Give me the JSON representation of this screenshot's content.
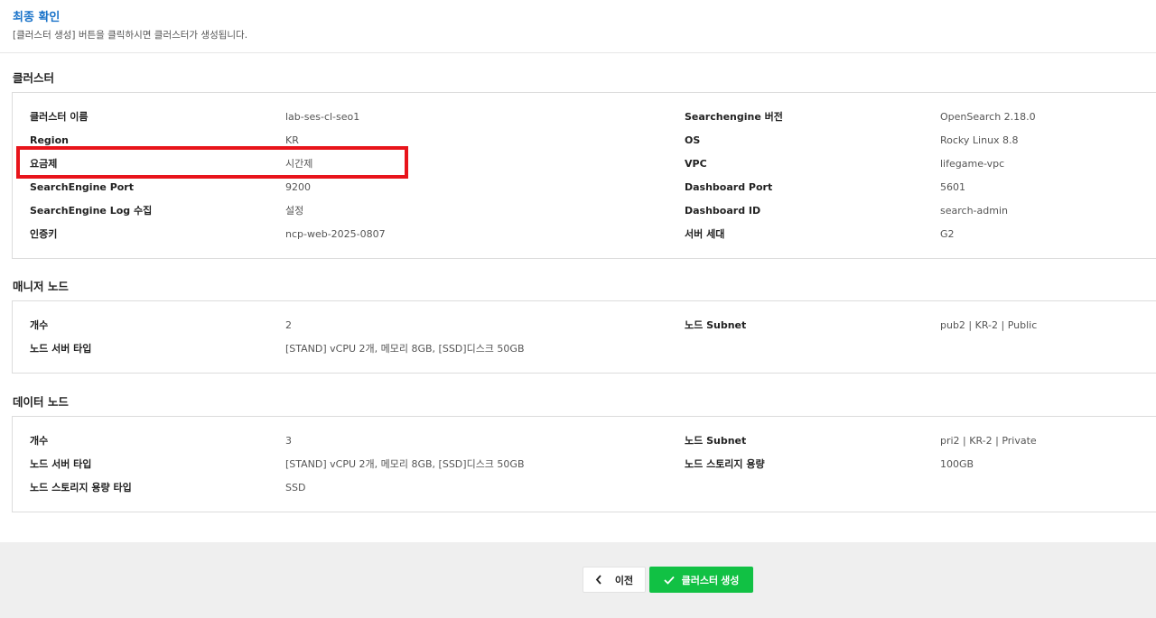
{
  "header": {
    "title": "최종 확인",
    "description": "[클러스터 생성] 버튼을 클릭하시면 클러스터가 생성됩니다."
  },
  "cluster": {
    "section_title": "클러스터",
    "left": [
      {
        "label": "클러스터 이름",
        "value": "lab-ses-cl-seo1"
      },
      {
        "label": "Region",
        "value": "KR"
      },
      {
        "label": "요금제",
        "value": "시간제"
      },
      {
        "label": "SearchEngine Port",
        "value": "9200"
      },
      {
        "label": "SearchEngine Log 수집",
        "value": "설정"
      },
      {
        "label": "인증키",
        "value": "ncp-web-2025-0807"
      }
    ],
    "right": [
      {
        "label": "Searchengine 버전",
        "value": "OpenSearch 2.18.0"
      },
      {
        "label": "OS",
        "value": "Rocky Linux 8.8"
      },
      {
        "label": "VPC",
        "value": "lifegame-vpc"
      },
      {
        "label": "Dashboard Port",
        "value": "5601"
      },
      {
        "label": "Dashboard ID",
        "value": "search-admin"
      },
      {
        "label": "서버 세대",
        "value": "G2"
      }
    ]
  },
  "manager": {
    "section_title": "매니저 노드",
    "left": [
      {
        "label": "개수",
        "value": "2"
      },
      {
        "label": "노드 서버 타입",
        "value": "[STAND] vCPU 2개, 메모리 8GB, [SSD]디스크 50GB"
      }
    ],
    "right": [
      {
        "label": "노드 Subnet",
        "value": "pub2 | KR-2 | Public"
      }
    ]
  },
  "data_node": {
    "section_title": "데이터 노드",
    "left": [
      {
        "label": "개수",
        "value": "3"
      },
      {
        "label": "노드 서버 타입",
        "value": "[STAND] vCPU 2개, 메모리 8GB, [SSD]디스크 50GB"
      },
      {
        "label": "노드 스토리지 용량 타입",
        "value": "SSD"
      }
    ],
    "right": [
      {
        "label": "노드 Subnet",
        "value": "pri2 | KR-2 | Private"
      },
      {
        "label": "노드 스토리지 용량",
        "value": "100GB"
      }
    ]
  },
  "footer": {
    "prev_label": "이전",
    "create_label": "클러스터 생성"
  },
  "colors": {
    "accent": "#1a73c9",
    "create_button": "#11c144",
    "highlight": "#e8141b"
  }
}
